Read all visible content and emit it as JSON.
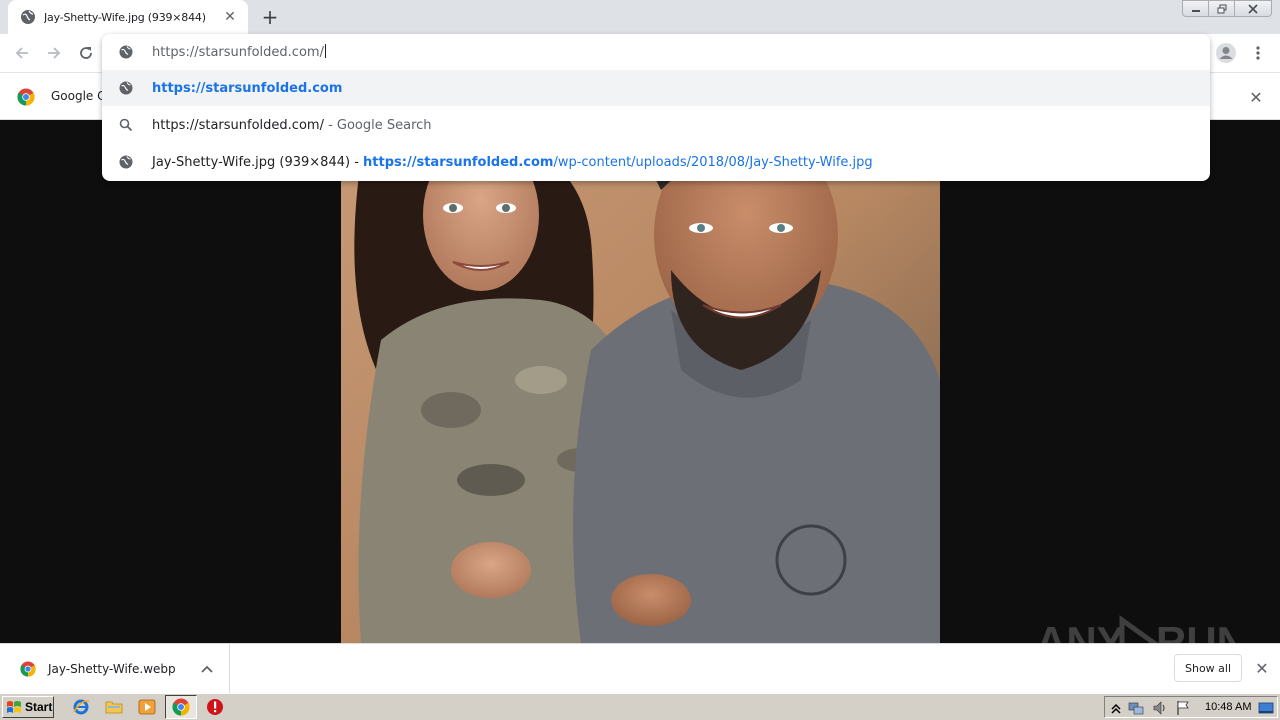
{
  "tab": {
    "title": "Jay-Shetty-Wife.jpg (939×844)",
    "new_tab_symbol": "+"
  },
  "omnibox": {
    "input_value": "https://starsunfolded.com/",
    "suggestions": [
      {
        "icon": "globe-icon",
        "url_bold": "https://starsunfolded.com",
        "selected": true
      },
      {
        "icon": "search-icon",
        "query": "https://starsunfolded.com/",
        "suffix": " - Google Search"
      },
      {
        "icon": "globe-icon",
        "title": "Jay-Shetty-Wife.jpg (939×844)",
        "separator": " - ",
        "url_bold": "https://starsunfolded.com",
        "url_rest": "/wp-content/uploads/2018/08/Jay-Shetty-Wife.jpg"
      }
    ]
  },
  "infobar": {
    "text": "Google Cl"
  },
  "download_shelf": {
    "file_name": "Jay-Shetty-Wife.webp",
    "show_all_label": "Show all"
  },
  "watermark": {
    "text": "ANY",
    "text2": "RUN"
  },
  "taskbar": {
    "start_label": "Start",
    "clock": "10:48 AM"
  },
  "colors": {
    "accent": "#1a73e8",
    "tabstrip": "#dee1e6",
    "viewer_bg": "#0e0e0e",
    "taskbar": "#d4d0c8"
  }
}
